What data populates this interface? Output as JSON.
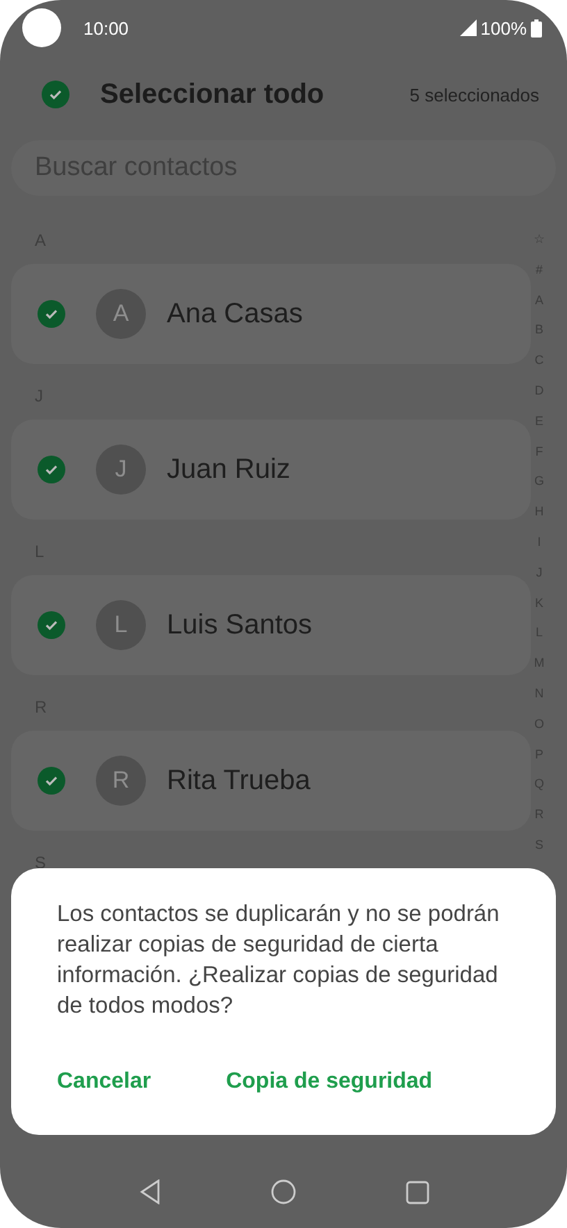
{
  "status_bar": {
    "time": "10:00",
    "battery": "100%"
  },
  "header": {
    "title": "Seleccionar todo",
    "checked": true,
    "count": "5 seleccionados"
  },
  "search": {
    "placeholder": "Buscar contactos"
  },
  "sections": [
    {
      "letter": "A",
      "contacts": [
        {
          "initial": "A",
          "name": "Ana Casas",
          "checked": true
        }
      ]
    },
    {
      "letter": "J",
      "contacts": [
        {
          "initial": "J",
          "name": "Juan Ruiz",
          "checked": true
        }
      ]
    },
    {
      "letter": "L",
      "contacts": [
        {
          "initial": "L",
          "name": "Luis Santos",
          "checked": true
        }
      ]
    },
    {
      "letter": "R",
      "contacts": [
        {
          "initial": "R",
          "name": "Rita Trueba",
          "checked": true
        }
      ]
    },
    {
      "letter": "S"
    }
  ],
  "index": [
    "☆",
    "#",
    "A",
    "B",
    "C",
    "D",
    "E",
    "F",
    "G",
    "H",
    "I",
    "J",
    "K",
    "L",
    "M",
    "N",
    "O",
    "P",
    "Q",
    "R",
    "S"
  ],
  "dialog": {
    "message": "Los contactos se duplicarán y no se podrán realizar copias de seguridad de cierta información. ¿Realizar copias de seguridad de todos modos?",
    "buttons": [
      "Cancelar",
      "Copia de seguridad"
    ]
  }
}
